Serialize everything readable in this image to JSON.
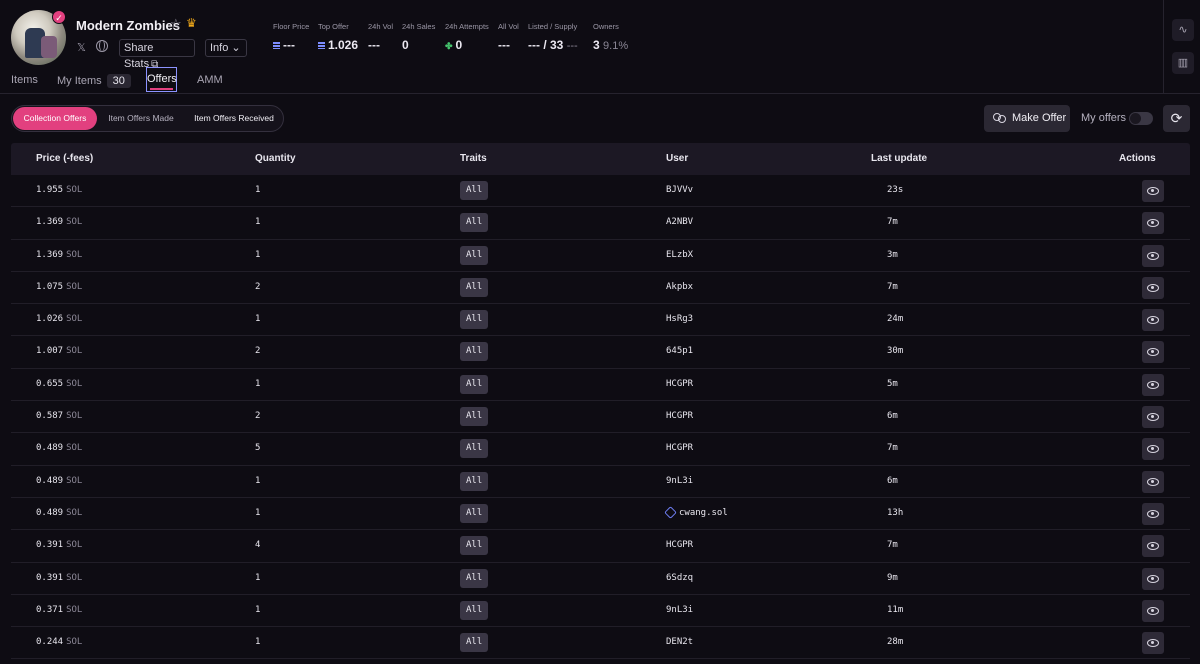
{
  "collection": {
    "name": "Modern Zombies",
    "share_label": "Share Stats",
    "share_icon": "external-link-icon",
    "info_label": "Info",
    "verified_icon": "check-badge-icon"
  },
  "stats": [
    {
      "label": "Floor Price",
      "value": "---",
      "icon": "sol"
    },
    {
      "label": "Top Offer",
      "value": "1.026",
      "icon": "sol"
    },
    {
      "label": "24h Vol",
      "value": "---"
    },
    {
      "label": "24h Sales",
      "value": "0"
    },
    {
      "label": "24h Attempts",
      "value": "0",
      "icon": "clover"
    },
    {
      "label": "All Vol",
      "value": "---"
    },
    {
      "label": "Listed / Supply",
      "value": "--- / 33",
      "sub": "---"
    },
    {
      "label": "Owners",
      "value": "3",
      "sub": "9.1%"
    }
  ],
  "tabs": {
    "items": "Items",
    "my_items": "My Items",
    "my_items_count": "30",
    "offers": "Offers",
    "amm": "AMM"
  },
  "toolbar": {
    "collection_offers": "Collection Offers",
    "item_offers_made": "Item Offers Made",
    "item_offers_received": "Item Offers Received",
    "make_offer": "Make Offer",
    "my_offers": "My offers",
    "my_offers_enabled": false
  },
  "table": {
    "headers": {
      "price": "Price (-fees)",
      "quantity": "Quantity",
      "traits": "Traits",
      "user": "User",
      "last_update": "Last update",
      "actions": "Actions"
    },
    "unit": "SOL",
    "rows": [
      {
        "price": "1.955",
        "qty": "1",
        "traits": "All",
        "user": "BJVVv",
        "update": "23s"
      },
      {
        "price": "1.369",
        "qty": "1",
        "traits": "All",
        "user": "A2NBV",
        "update": "7m"
      },
      {
        "price": "1.369",
        "qty": "1",
        "traits": "All",
        "user": "ELzbX",
        "update": "3m"
      },
      {
        "price": "1.075",
        "qty": "2",
        "traits": "All",
        "user": "Akpbx",
        "update": "7m"
      },
      {
        "price": "1.026",
        "qty": "1",
        "traits": "All",
        "user": "HsRg3",
        "update": "24m"
      },
      {
        "price": "1.007",
        "qty": "2",
        "traits": "All",
        "user": "645p1",
        "update": "30m"
      },
      {
        "price": "0.655",
        "qty": "1",
        "traits": "All",
        "user": "HCGPR",
        "update": "5m"
      },
      {
        "price": "0.587",
        "qty": "2",
        "traits": "All",
        "user": "HCGPR",
        "update": "6m"
      },
      {
        "price": "0.489",
        "qty": "5",
        "traits": "All",
        "user": "HCGPR",
        "update": "7m"
      },
      {
        "price": "0.489",
        "qty": "1",
        "traits": "All",
        "user": "9nL3i",
        "update": "6m"
      },
      {
        "price": "0.489",
        "qty": "1",
        "traits": "All",
        "user": "cwang.sol",
        "update": "13h",
        "user_icon": "sns-domain-icon"
      },
      {
        "price": "0.391",
        "qty": "4",
        "traits": "All",
        "user": "HCGPR",
        "update": "7m"
      },
      {
        "price": "0.391",
        "qty": "1",
        "traits": "All",
        "user": "6Sdzq",
        "update": "9m"
      },
      {
        "price": "0.371",
        "qty": "1",
        "traits": "All",
        "user": "9nL3i",
        "update": "11m"
      },
      {
        "price": "0.244",
        "qty": "1",
        "traits": "All",
        "user": "DEN2t",
        "update": "28m"
      }
    ]
  },
  "colors": {
    "background": "#0e0c13",
    "accent_pink": "#e2407f",
    "sol_blue": "#7c8cff",
    "clover_green": "#45c46d",
    "crown_gold": "#f0a91a"
  }
}
